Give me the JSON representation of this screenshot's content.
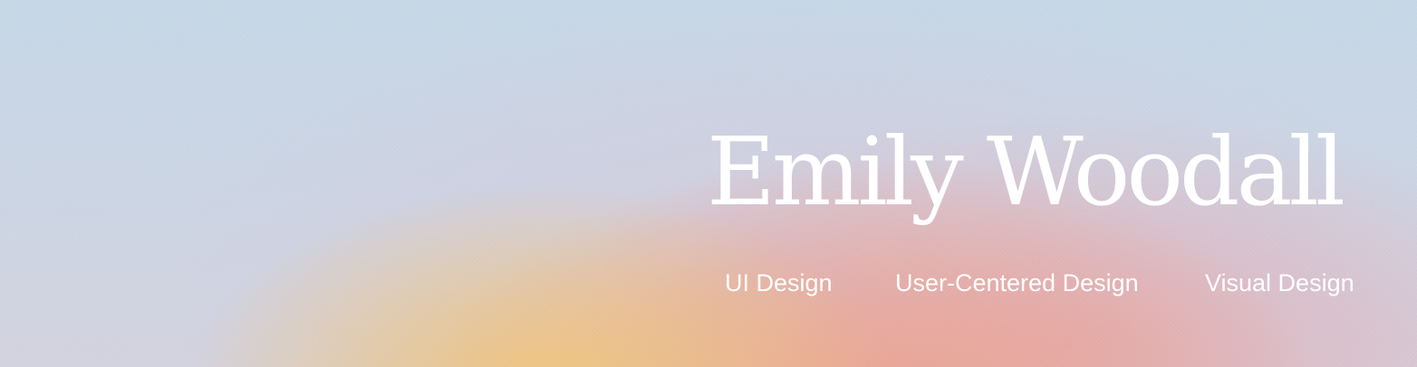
{
  "header": {
    "name": "Emily Woodall",
    "skills": [
      "UI Design",
      "User-Centered Design",
      "Visual Design"
    ]
  },
  "colors": {
    "text": "#ffffff",
    "background_blue": "#c8d6e3",
    "gradient_yellow": "#f0c478",
    "gradient_coral": "#eca08c",
    "gradient_pink": "#e2acb4"
  }
}
